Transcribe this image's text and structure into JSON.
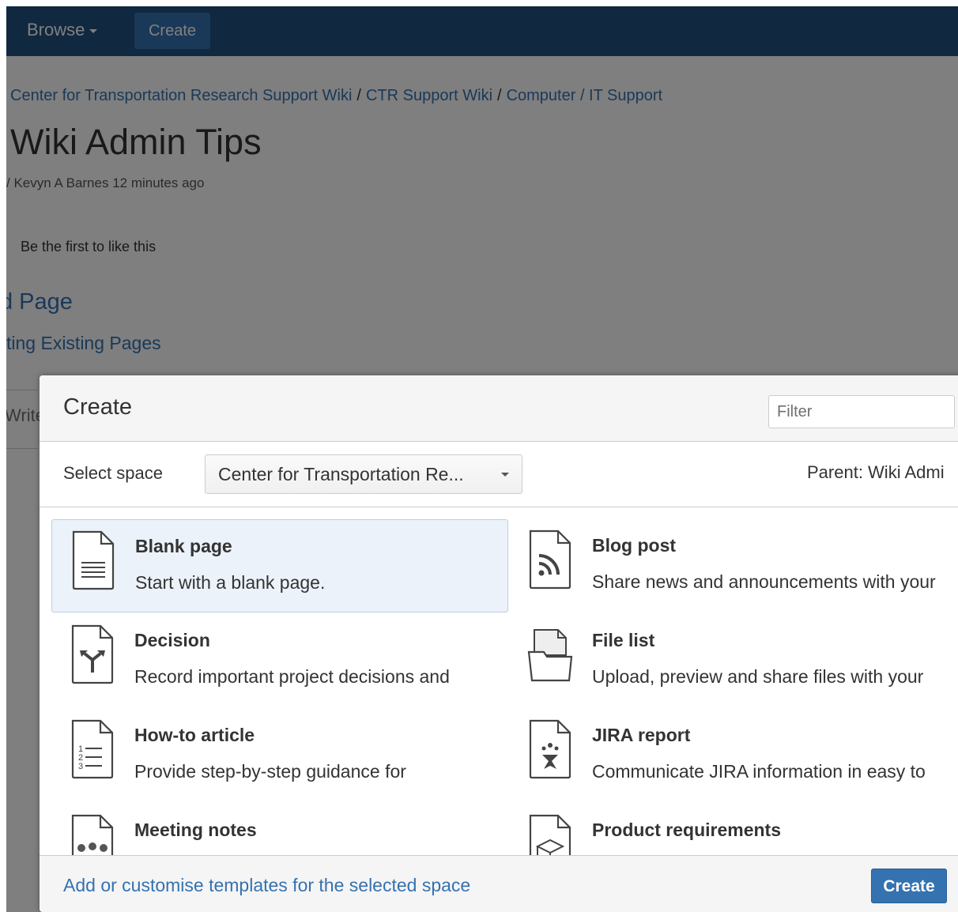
{
  "topnav": {
    "browse_label": "Browse",
    "create_label": "Create"
  },
  "breadcrumb": [
    "Center for Transportation Research Support Wiki",
    "CTR Support Wiki",
    "Computer / IT Support"
  ],
  "breadcrumb_separator": "/",
  "page": {
    "title": "Wiki Admin Tips",
    "byline": "/ Kevyn A Barnes 12 minutes ago",
    "likes": "Be the first to like this",
    "heading_fragment": "d Page",
    "link_fragment": "ting Existing Pages",
    "comment_fragment": "Write"
  },
  "dialog": {
    "title": "Create",
    "filter_placeholder": "Filter",
    "select_space_label": "Select space",
    "space_value": "Center for Transportation Re...",
    "parent_label": "Parent: Wiki Admi",
    "templates": [
      {
        "name": "Blank page",
        "desc": "Start with a blank page.",
        "icon": "blank-page-icon",
        "selected": true
      },
      {
        "name": "Blog post",
        "desc": "Share news and announcements with your",
        "icon": "blog-post-icon",
        "selected": false
      },
      {
        "name": "Decision",
        "desc": "Record important project decisions and",
        "icon": "decision-icon",
        "selected": false
      },
      {
        "name": "File list",
        "desc": "Upload, preview and share files with your",
        "icon": "file-list-icon",
        "selected": false
      },
      {
        "name": "How-to article",
        "desc": "Provide step-by-step guidance for",
        "icon": "how-to-article-icon",
        "selected": false
      },
      {
        "name": "JIRA report",
        "desc": "Communicate JIRA information in easy to",
        "icon": "jira-report-icon",
        "selected": false
      },
      {
        "name": "Meeting notes",
        "desc": "",
        "icon": "meeting-notes-icon",
        "selected": false
      },
      {
        "name": "Product requirements",
        "desc": "",
        "icon": "product-requirements-icon",
        "selected": false
      }
    ],
    "footer_link": "Add or customise templates for the selected space",
    "create_button": "Create"
  },
  "colors": {
    "nav": "#205081",
    "accent": "#3572b0",
    "selected": "#ebf2f9"
  }
}
